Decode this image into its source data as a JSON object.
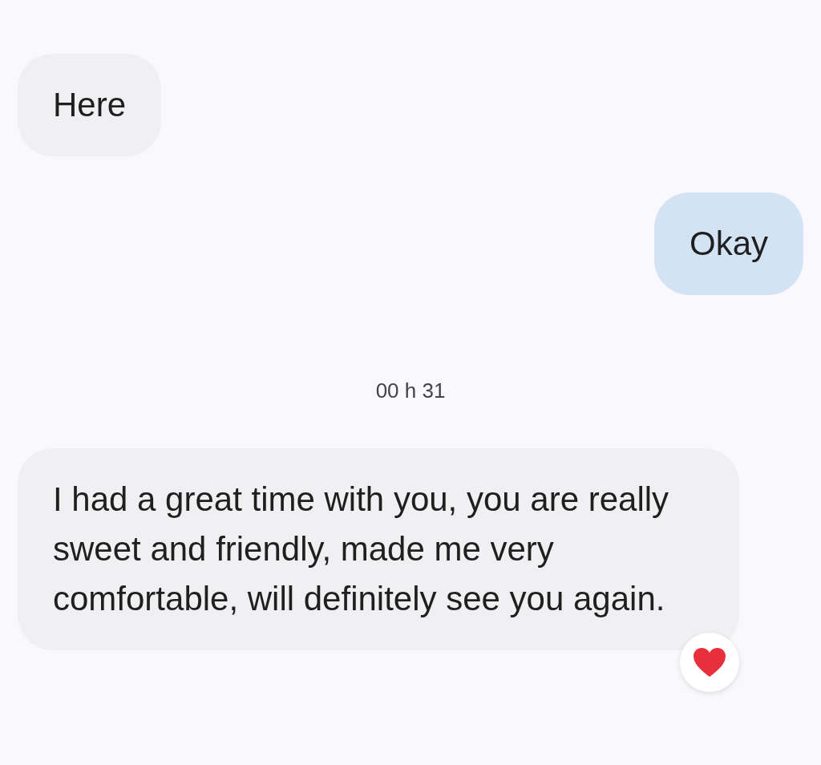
{
  "messages": [
    {
      "kind": "incoming",
      "text": "Here",
      "reacted": false
    },
    {
      "kind": "outgoing",
      "text": "Okay",
      "reacted": false
    },
    {
      "kind": "timestamp",
      "text": "00 h 31"
    },
    {
      "kind": "incoming",
      "text": "I had a great time with you, you are really sweet and friendly, made me very comfortable, will definitely see you again.",
      "reacted": true
    }
  ]
}
